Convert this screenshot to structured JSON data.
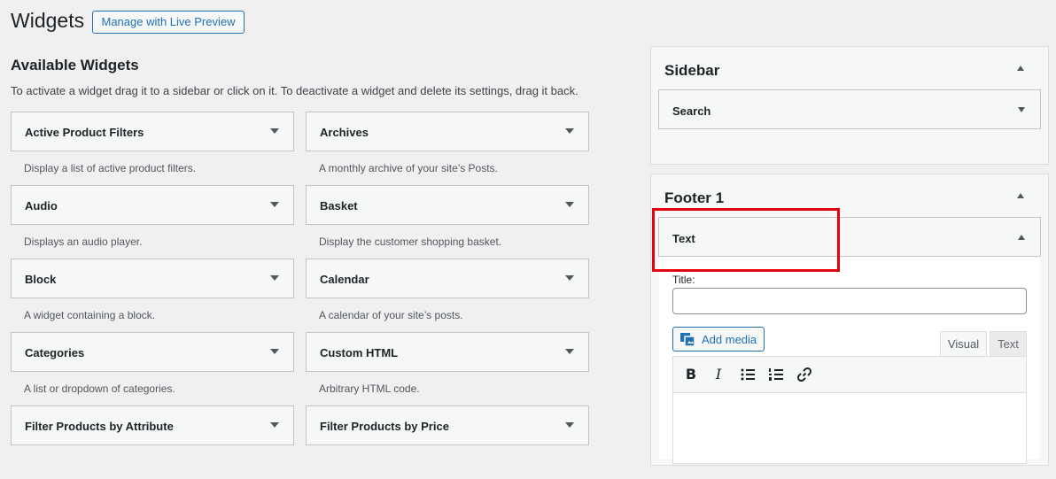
{
  "header": {
    "title": "Widgets",
    "live_preview_label": "Manage with Live Preview"
  },
  "available": {
    "heading": "Available Widgets",
    "description": "To activate a widget drag it to a sidebar or click on it. To deactivate a widget and delete its settings, drag it back.",
    "left": [
      {
        "title": "Active Product Filters",
        "desc": "Display a list of active product filters."
      },
      {
        "title": "Audio",
        "desc": "Displays an audio player."
      },
      {
        "title": "Block",
        "desc": "A widget containing a block."
      },
      {
        "title": "Categories",
        "desc": "A list or dropdown of categories."
      },
      {
        "title": "Filter Products by Attribute",
        "desc": ""
      }
    ],
    "right": [
      {
        "title": "Archives",
        "desc": "A monthly archive of your site’s Posts."
      },
      {
        "title": "Basket",
        "desc": "Display the customer shopping basket."
      },
      {
        "title": "Calendar",
        "desc": "A calendar of your site’s posts."
      },
      {
        "title": "Custom HTML",
        "desc": "Arbitrary HTML code."
      },
      {
        "title": "Filter Products by Price",
        "desc": ""
      }
    ]
  },
  "sidebar": {
    "title": "Sidebar",
    "widget_title": "Search"
  },
  "footer1": {
    "title": "Footer 1",
    "widget_title": "Text",
    "form": {
      "title_label": "Title:",
      "title_value": "",
      "add_media_label": "Add media",
      "tab_visual": "Visual",
      "tab_text": "Text"
    }
  },
  "colors": {
    "accent": "#2271b1",
    "highlight": "#e3000f"
  }
}
